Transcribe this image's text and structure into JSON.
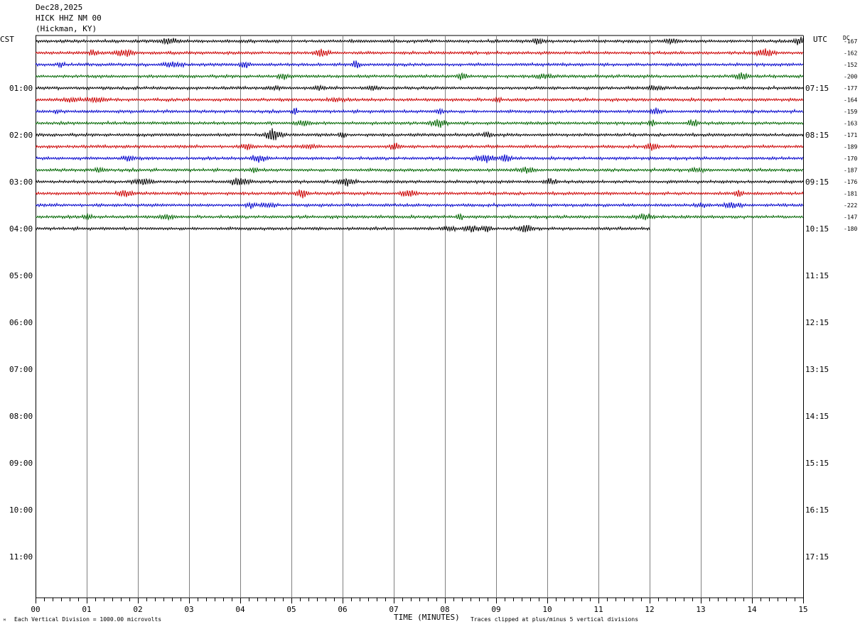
{
  "header": {
    "date": "Dec28,2025",
    "station": "HICK HHZ NM 00",
    "location": "(Hickman, KY)"
  },
  "left_zone": "CST",
  "right_zone": "UTC",
  "dc_label": "DC",
  "footer": {
    "xlabel": "TIME (MINUTES)",
    "scale_note": "Each Vertical Division = 1000.00 microvolts",
    "clip_note": "Traces clipped at plus/minus 5 vertical divisions",
    "logo_mark": "ᴹ"
  },
  "colors": {
    "trace_cycle": [
      "#000000",
      "#cc0000",
      "#0000cc",
      "#006600"
    ],
    "grid": "#808080",
    "axis": "#000000"
  },
  "chart_data": {
    "type": "line",
    "title": "",
    "xlabel": "TIME (MINUTES)",
    "ylabel": "",
    "x_range": [
      0,
      15
    ],
    "x_ticks": [
      "00",
      "01",
      "02",
      "03",
      "04",
      "05",
      "06",
      "07",
      "08",
      "09",
      "10",
      "11",
      "12",
      "13",
      "14",
      "15"
    ],
    "minutes_per_row": 15,
    "rows_total": 44,
    "hour_labels_left": [
      "01:00",
      "02:00",
      "03:00",
      "04:00",
      "05:00",
      "06:00",
      "07:00",
      "08:00",
      "09:00",
      "10:00",
      "11:00"
    ],
    "hour_labels_right": [
      "07:15",
      "08:15",
      "09:15",
      "10:15",
      "11:15",
      "12:15",
      "13:15",
      "14:15",
      "15:15",
      "16:15",
      "17:15"
    ],
    "grid": true,
    "traces": [
      {
        "dc": "-167",
        "end_minute": 15
      },
      {
        "dc": "-162",
        "end_minute": 15
      },
      {
        "dc": "-152",
        "end_minute": 15
      },
      {
        "dc": "-200",
        "end_minute": 15
      },
      {
        "dc": "-177",
        "end_minute": 15
      },
      {
        "dc": "-164",
        "end_minute": 15
      },
      {
        "dc": "-159",
        "end_minute": 15
      },
      {
        "dc": "-163",
        "end_minute": 15
      },
      {
        "dc": "-171",
        "end_minute": 15
      },
      {
        "dc": "-189",
        "end_minute": 15
      },
      {
        "dc": "-170",
        "end_minute": 15
      },
      {
        "dc": "-187",
        "end_minute": 15
      },
      {
        "dc": "-176",
        "end_minute": 15
      },
      {
        "dc": "-181",
        "end_minute": 15
      },
      {
        "dc": "-222",
        "end_minute": 15
      },
      {
        "dc": "-147",
        "end_minute": 15
      },
      {
        "dc": "-180",
        "end_minute": 12
      }
    ]
  }
}
